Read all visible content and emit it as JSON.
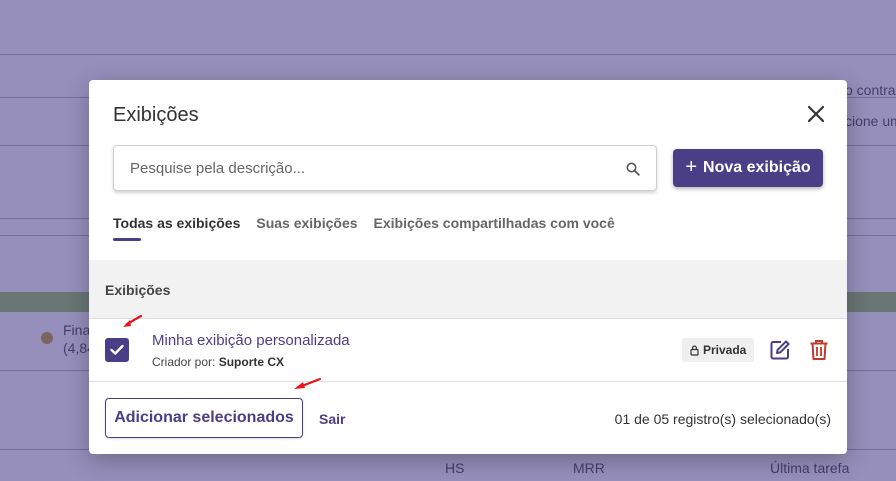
{
  "background": {
    "right_text_1": "o contra",
    "right_text_2": "cione um",
    "left_text_1": "Fina",
    "left_text_2": "(4,84",
    "col_hs": "HS",
    "col_mrr": "MRR",
    "col_last_task": "Última tarefa"
  },
  "modal": {
    "title": "Exibições",
    "search": {
      "placeholder": "Pesquise pela descrição...",
      "value": ""
    },
    "new_button_label": "Nova exibição",
    "tabs": [
      {
        "label": "Todas as exibições",
        "active": true
      },
      {
        "label": "Suas exibições",
        "active": false
      },
      {
        "label": "Exibições compartilhadas com você",
        "active": false
      }
    ],
    "list_header": "Exibições",
    "rows": [
      {
        "title": "Minha exibição personalizada",
        "creator_prefix": "Criador por:",
        "creator": "Suporte CX",
        "badge": "Privada",
        "checked": true
      }
    ],
    "footer": {
      "add_button_label": "Adicionar selecionados",
      "exit_label": "Sair",
      "count_text": "01 de 05 registro(s) selecionado(s)"
    }
  },
  "colors": {
    "accent": "#4a3f86",
    "delete": "#c0392b",
    "annotation_arrow": "#e8141c"
  },
  "icons": [
    "close-icon",
    "search-icon",
    "plus-icon",
    "check-icon",
    "lock-icon",
    "edit-icon",
    "trash-icon",
    "arrow-annotation-icon"
  ]
}
